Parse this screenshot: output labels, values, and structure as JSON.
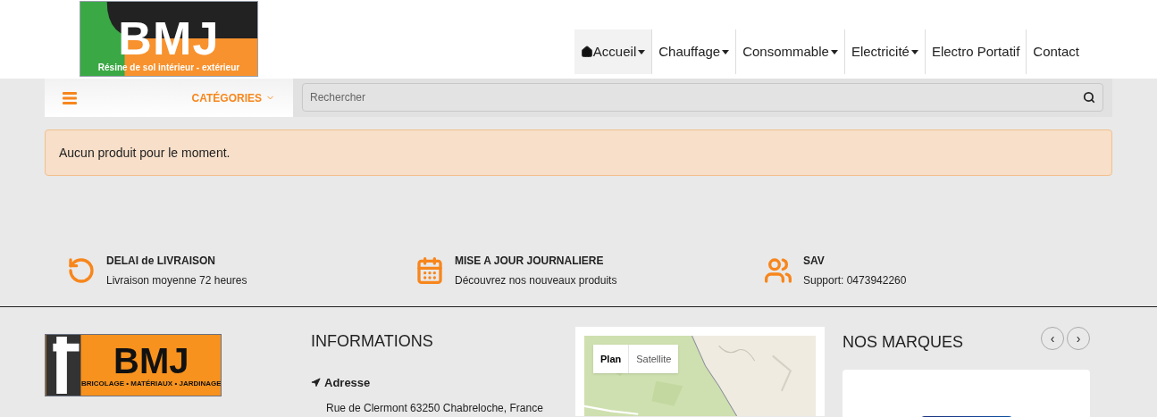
{
  "header": {
    "logo": {
      "title": "BMJ",
      "tagline": "Résine de sol intérieur - extérieur"
    },
    "nav": [
      {
        "label": "Accueil",
        "kind": "home",
        "selected": true,
        "dropdown": true
      },
      {
        "label": "Chauffage",
        "kind": "link",
        "selected": false,
        "dropdown": true
      },
      {
        "label": "Consommable",
        "kind": "link",
        "selected": false,
        "dropdown": true
      },
      {
        "label": "Electricité",
        "kind": "link",
        "selected": false,
        "dropdown": true
      },
      {
        "label": "Electro Portatif",
        "kind": "link",
        "selected": false,
        "dropdown": false
      },
      {
        "label": "Contact",
        "kind": "link",
        "selected": false,
        "dropdown": false
      }
    ]
  },
  "toolbar": {
    "categories": "CATÉGORIES",
    "search": {
      "placeholder": "Rechercher"
    }
  },
  "alert": "Aucun produit pour le moment.",
  "features": [
    {
      "title": "DELAI de LIVRAISON",
      "text": "Livraison moyenne 72 heures"
    },
    {
      "title": "MISE A JOUR JOURNALIERE",
      "text": "Découvrez nos nouveaux produits"
    },
    {
      "title": "SAV",
      "text": "Support: 0473942260"
    }
  ],
  "footer": {
    "logo": {
      "title": "BMJ",
      "tagline": "BRICOLAGE • MATÉRIAUX • JARDINAGE"
    },
    "informations": {
      "heading": "INFORMATIONS",
      "address_label": "Adresse",
      "address": "Rue de Clermont 63250 Chabreloche, France"
    },
    "map": {
      "kind": "picture",
      "buttons": [
        {
          "label": "Plan",
          "selected": true
        },
        {
          "label": "Satellite",
          "selected": false
        }
      ]
    },
    "brands": {
      "heading": "NOS MARQUES",
      "prev": "‹",
      "next": "›"
    }
  }
}
